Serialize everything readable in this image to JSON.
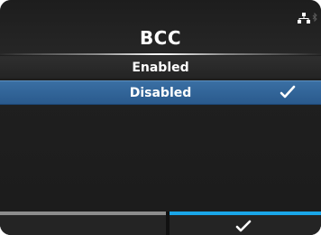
{
  "header": {
    "title": "BCC",
    "status_icons": [
      "network-icon",
      "bluetooth-icon"
    ]
  },
  "options": [
    {
      "label": "Enabled",
      "selected": false
    },
    {
      "label": "Disabled",
      "selected": true,
      "icon": "check-icon"
    }
  ],
  "footer": {
    "left_button_label": "",
    "right_button_icon": "check-icon"
  },
  "colors": {
    "background": "#222222",
    "selected_row": "#2f6396",
    "footer_accent": "#1aa6e8",
    "footer_left_accent": "#8c8c8c",
    "text": "#ffffff"
  }
}
